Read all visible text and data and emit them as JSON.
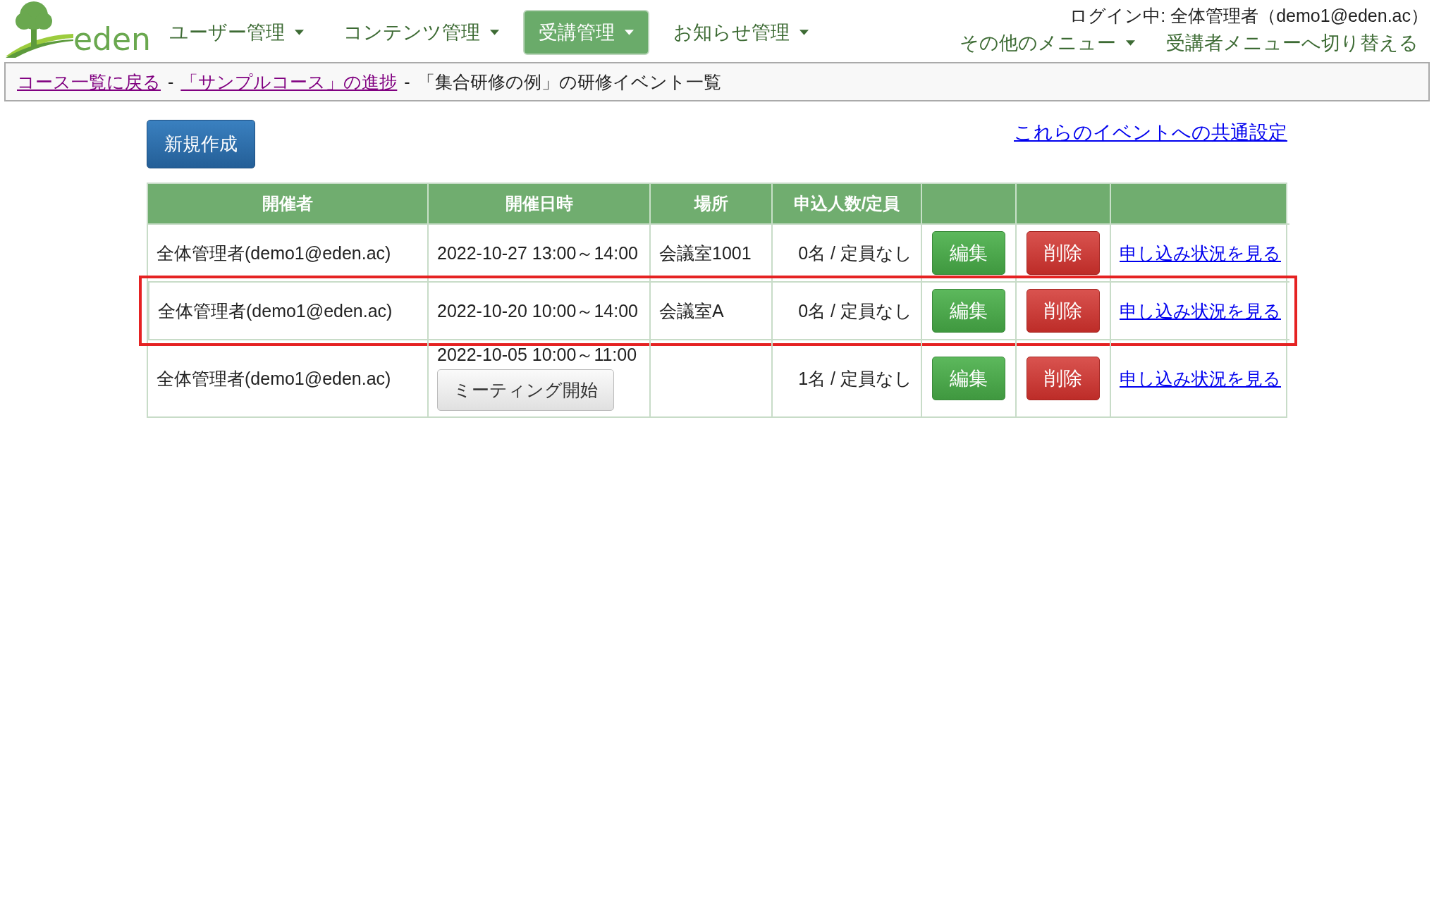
{
  "logo": {
    "text": "eden"
  },
  "nav": {
    "items": [
      {
        "label": "ユーザー管理",
        "selected": false,
        "dropdown": true
      },
      {
        "label": "コンテンツ管理",
        "selected": false,
        "dropdown": true
      },
      {
        "label": "受講管理",
        "selected": true,
        "dropdown": true
      },
      {
        "label": "お知らせ管理",
        "selected": false,
        "dropdown": true
      }
    ],
    "login": "ログイン中: 全体管理者（demo1@eden.ac）",
    "right_items": [
      {
        "label": "その他のメニュー",
        "dropdown": true
      },
      {
        "label": "受講者メニューへ切り替える",
        "dropdown": false
      }
    ]
  },
  "breadcrumb": {
    "links": [
      "コース一覧に戻る",
      "「サンプルコース」の進捗"
    ],
    "separator": "-",
    "current": "「集合研修の例」の研修イベント一覧"
  },
  "create_button": "新規作成",
  "common_settings_link": "これらのイベントへの共通設定",
  "table": {
    "columns": [
      "開催者",
      "開催日時",
      "場所",
      "申込人数/定員"
    ],
    "rows": [
      {
        "organizer": "全体管理者(demo1@eden.ac)",
        "datetime": "2022-10-27 13:00～14:00",
        "place": "会議室1001",
        "count": "0名 / 定員なし",
        "edit": "編集",
        "delete": "削除",
        "link": "申し込み状況を見る",
        "highlighted": false
      },
      {
        "organizer": "全体管理者(demo1@eden.ac)",
        "datetime": "2022-10-20 10:00～14:00",
        "place": "会議室A",
        "count": "0名 / 定員なし",
        "edit": "編集",
        "delete": "削除",
        "link": "申し込み状況を見る",
        "highlighted": true
      },
      {
        "organizer": "全体管理者(demo1@eden.ac)",
        "datetime": "2022-10-05 10:00～11:00",
        "meeting_button": "ミーティング開始",
        "count": "1名 / 定員なし",
        "edit": "編集",
        "delete": "削除",
        "link": "申し込み状況を見る",
        "highlighted": false
      }
    ]
  }
}
